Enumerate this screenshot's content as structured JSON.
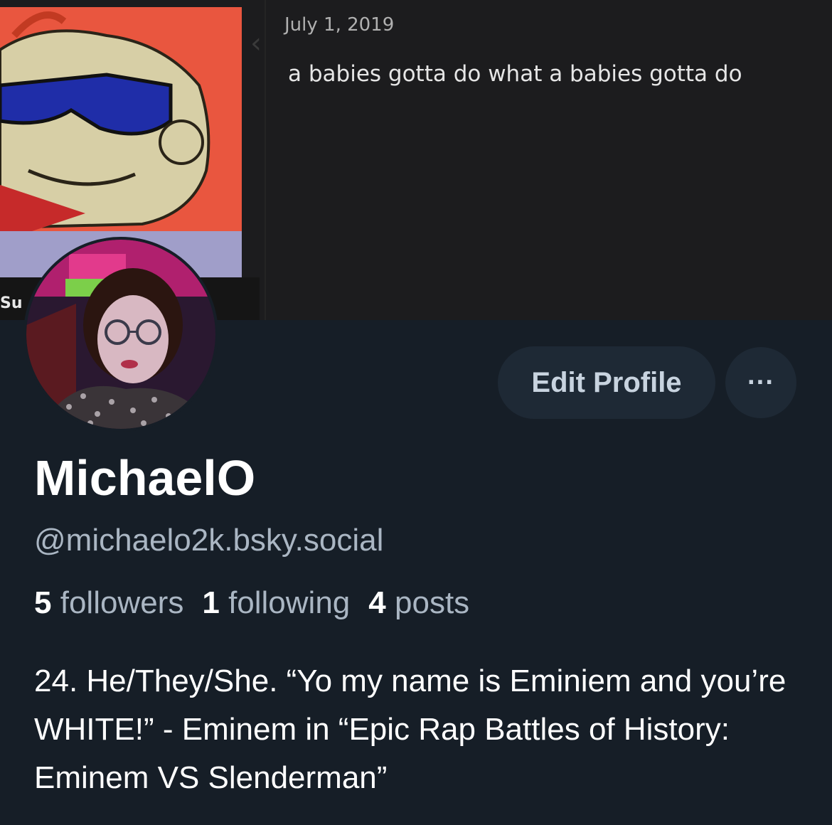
{
  "banner": {
    "meme_caption": "Su",
    "post_date": "July 1, 2019",
    "post_text": "a babies gotta do what a babies gotta do"
  },
  "profile": {
    "display_name": "MichaelO",
    "handle": "@michaelo2k.bsky.social",
    "edit_label": "Edit Profile",
    "more_label": "···",
    "stats": {
      "followers_count": "5",
      "followers_label": "followers",
      "following_count": "1",
      "following_label": "following",
      "posts_count": "4",
      "posts_label": "posts"
    },
    "bio": "24. He/They/She. “Yo my name is Eminiem and you’re WHITE!” - Eminem in “Epic Rap Battles of History: Eminem VS Slenderman”"
  },
  "colors": {
    "background": "#161e27",
    "button_bg": "#1e2935",
    "muted_text": "#aab6c3"
  }
}
